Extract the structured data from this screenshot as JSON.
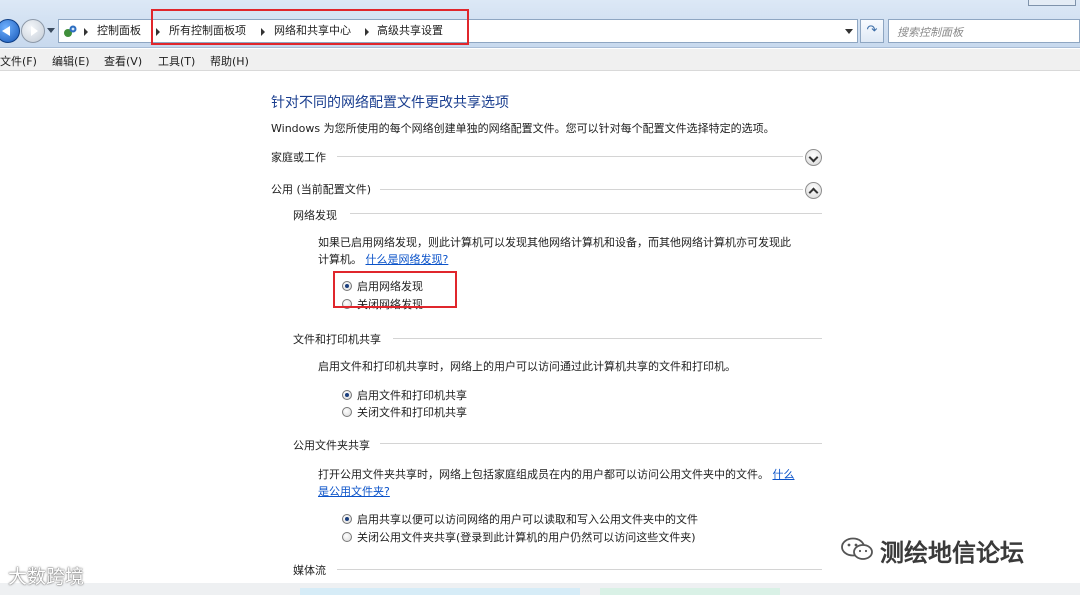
{
  "address_bar": {
    "breadcrumbs": [
      "控制面板",
      "所有控制面板项",
      "网络和共享中心",
      "高级共享设置"
    ],
    "search_placeholder": "搜索控制面板"
  },
  "menu": [
    "文件(F)",
    "编辑(E)",
    "查看(V)",
    "工具(T)",
    "帮助(H)"
  ],
  "main": {
    "title": "针对不同的网络配置文件更改共享选项",
    "description": "Windows 为您所使用的每个网络创建单独的网络配置文件。您可以针对每个配置文件选择特定的选项。",
    "profiles": [
      {
        "label": "家庭或工作",
        "expanded": false
      },
      {
        "label": "公用 (当前配置文件)",
        "expanded": true
      }
    ],
    "network_discovery": {
      "heading": "网络发现",
      "text_line1": "如果已启用网络发现，则此计算机可以发现其他网络计算机和设备，而其他网络计算机亦可发现此",
      "text_line2": "计算机。",
      "link": "什么是网络发现?",
      "options": [
        {
          "label": "启用网络发现",
          "selected": true
        },
        {
          "label": "关闭网络发现",
          "selected": false
        }
      ]
    },
    "file_printer_sharing": {
      "heading": "文件和打印机共享",
      "text": "启用文件和打印机共享时，网络上的用户可以访问通过此计算机共享的文件和打印机。",
      "options": [
        {
          "label": "启用文件和打印机共享",
          "selected": true
        },
        {
          "label": "关闭文件和打印机共享",
          "selected": false
        }
      ]
    },
    "public_folder_sharing": {
      "heading": "公用文件夹共享",
      "text": "打开公用文件夹共享时，网络上包括家庭组成员在内的用户都可以访问公用文件夹中的文件。",
      "link_part1": "什么",
      "link_part2": "是公用文件夹?",
      "options": [
        {
          "label": "启用共享以便可以访问网络的用户可以读取和写入公用文件夹中的文件",
          "selected": true
        },
        {
          "label": "关闭公用文件夹共享(登录到此计算机的用户仍然可以访问这些文件夹)",
          "selected": false
        }
      ]
    },
    "media_streaming": {
      "heading": "媒体流"
    }
  },
  "watermarks": {
    "left": "大数跨境",
    "right": "测绘地信论坛"
  },
  "colors": {
    "title_blue": "#1a3e8f",
    "link_blue": "#0b53c9",
    "highlight_red": "#e0262c"
  }
}
